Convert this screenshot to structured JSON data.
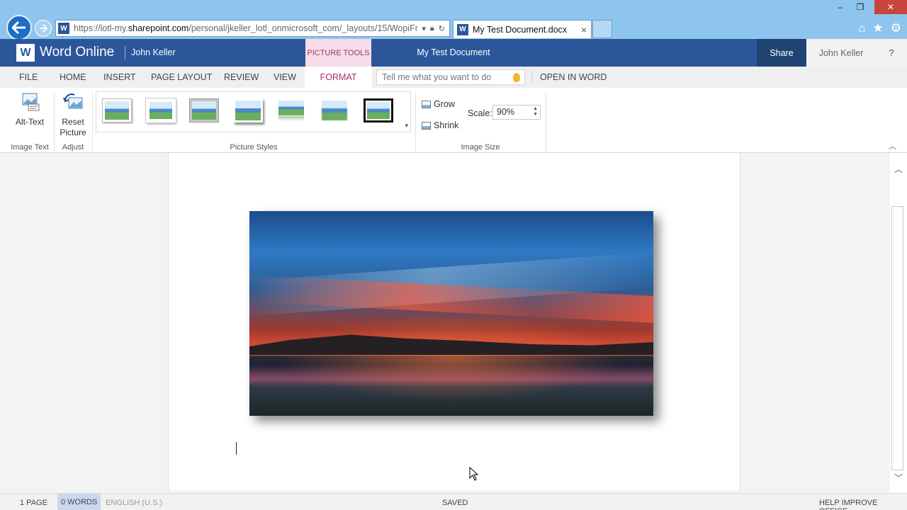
{
  "browser": {
    "url_prefix": "https://lotl-my.",
    "url_domain": "sharepoint.com",
    "url_rest": "/personal/jkeller_lotl_onmicrosoft_com/_layouts/15/WopiFr",
    "tab_title": "My Test Document.docx",
    "tab_close": "×",
    "favicon_letter": "W",
    "window": {
      "minimize": "–",
      "restore": "❐",
      "close": "✕"
    },
    "icons": [
      "home-icon",
      "star-icon",
      "settings-icon"
    ],
    "icon_glyphs": {
      "home": "⌂",
      "star": "★",
      "gear": "⚙"
    }
  },
  "header": {
    "logo_letter": "W",
    "app_name": "Word Online",
    "user": "John Keller",
    "picture_tools": "PICTURE TOOLS",
    "doc_title": "My Test Document",
    "share": "Share",
    "user_right": "John Keller",
    "help": "?"
  },
  "tabs": {
    "file": "FILE",
    "home": "HOME",
    "insert": "INSERT",
    "page_layout": "PAGE LAYOUT",
    "review": "REVIEW",
    "view": "VIEW",
    "format": "FORMAT",
    "tellme_placeholder": "Tell me what you want to do",
    "open_in_word": "OPEN IN WORD"
  },
  "ribbon": {
    "alt_text": "Alt-Text",
    "reset_line1": "Reset",
    "reset_line2": "Picture",
    "grow": "Grow",
    "shrink": "Shrink",
    "scale_label": "Scale:",
    "scale_value": "90%",
    "groups": {
      "image_text": "Image Text",
      "adjust": "Adjust",
      "picture_styles": "Picture Styles",
      "image_size": "Image Size"
    },
    "styles": [
      "Simple Frame",
      "White Frame",
      "Gray Frame",
      "Shadow",
      "Reflection",
      "Soft Edge",
      "Thick Black Frame"
    ]
  },
  "status": {
    "pages": "1 PAGE",
    "words": "0 WORDS",
    "language": "ENGLISH (U.S.)",
    "saved": "SAVED",
    "help_improve": "HELP IMPROVE OFFICE"
  },
  "colors": {
    "word_blue": "#2b579a",
    "accent_pink": "#a4316a",
    "browser_bar": "#8ec5ee"
  }
}
